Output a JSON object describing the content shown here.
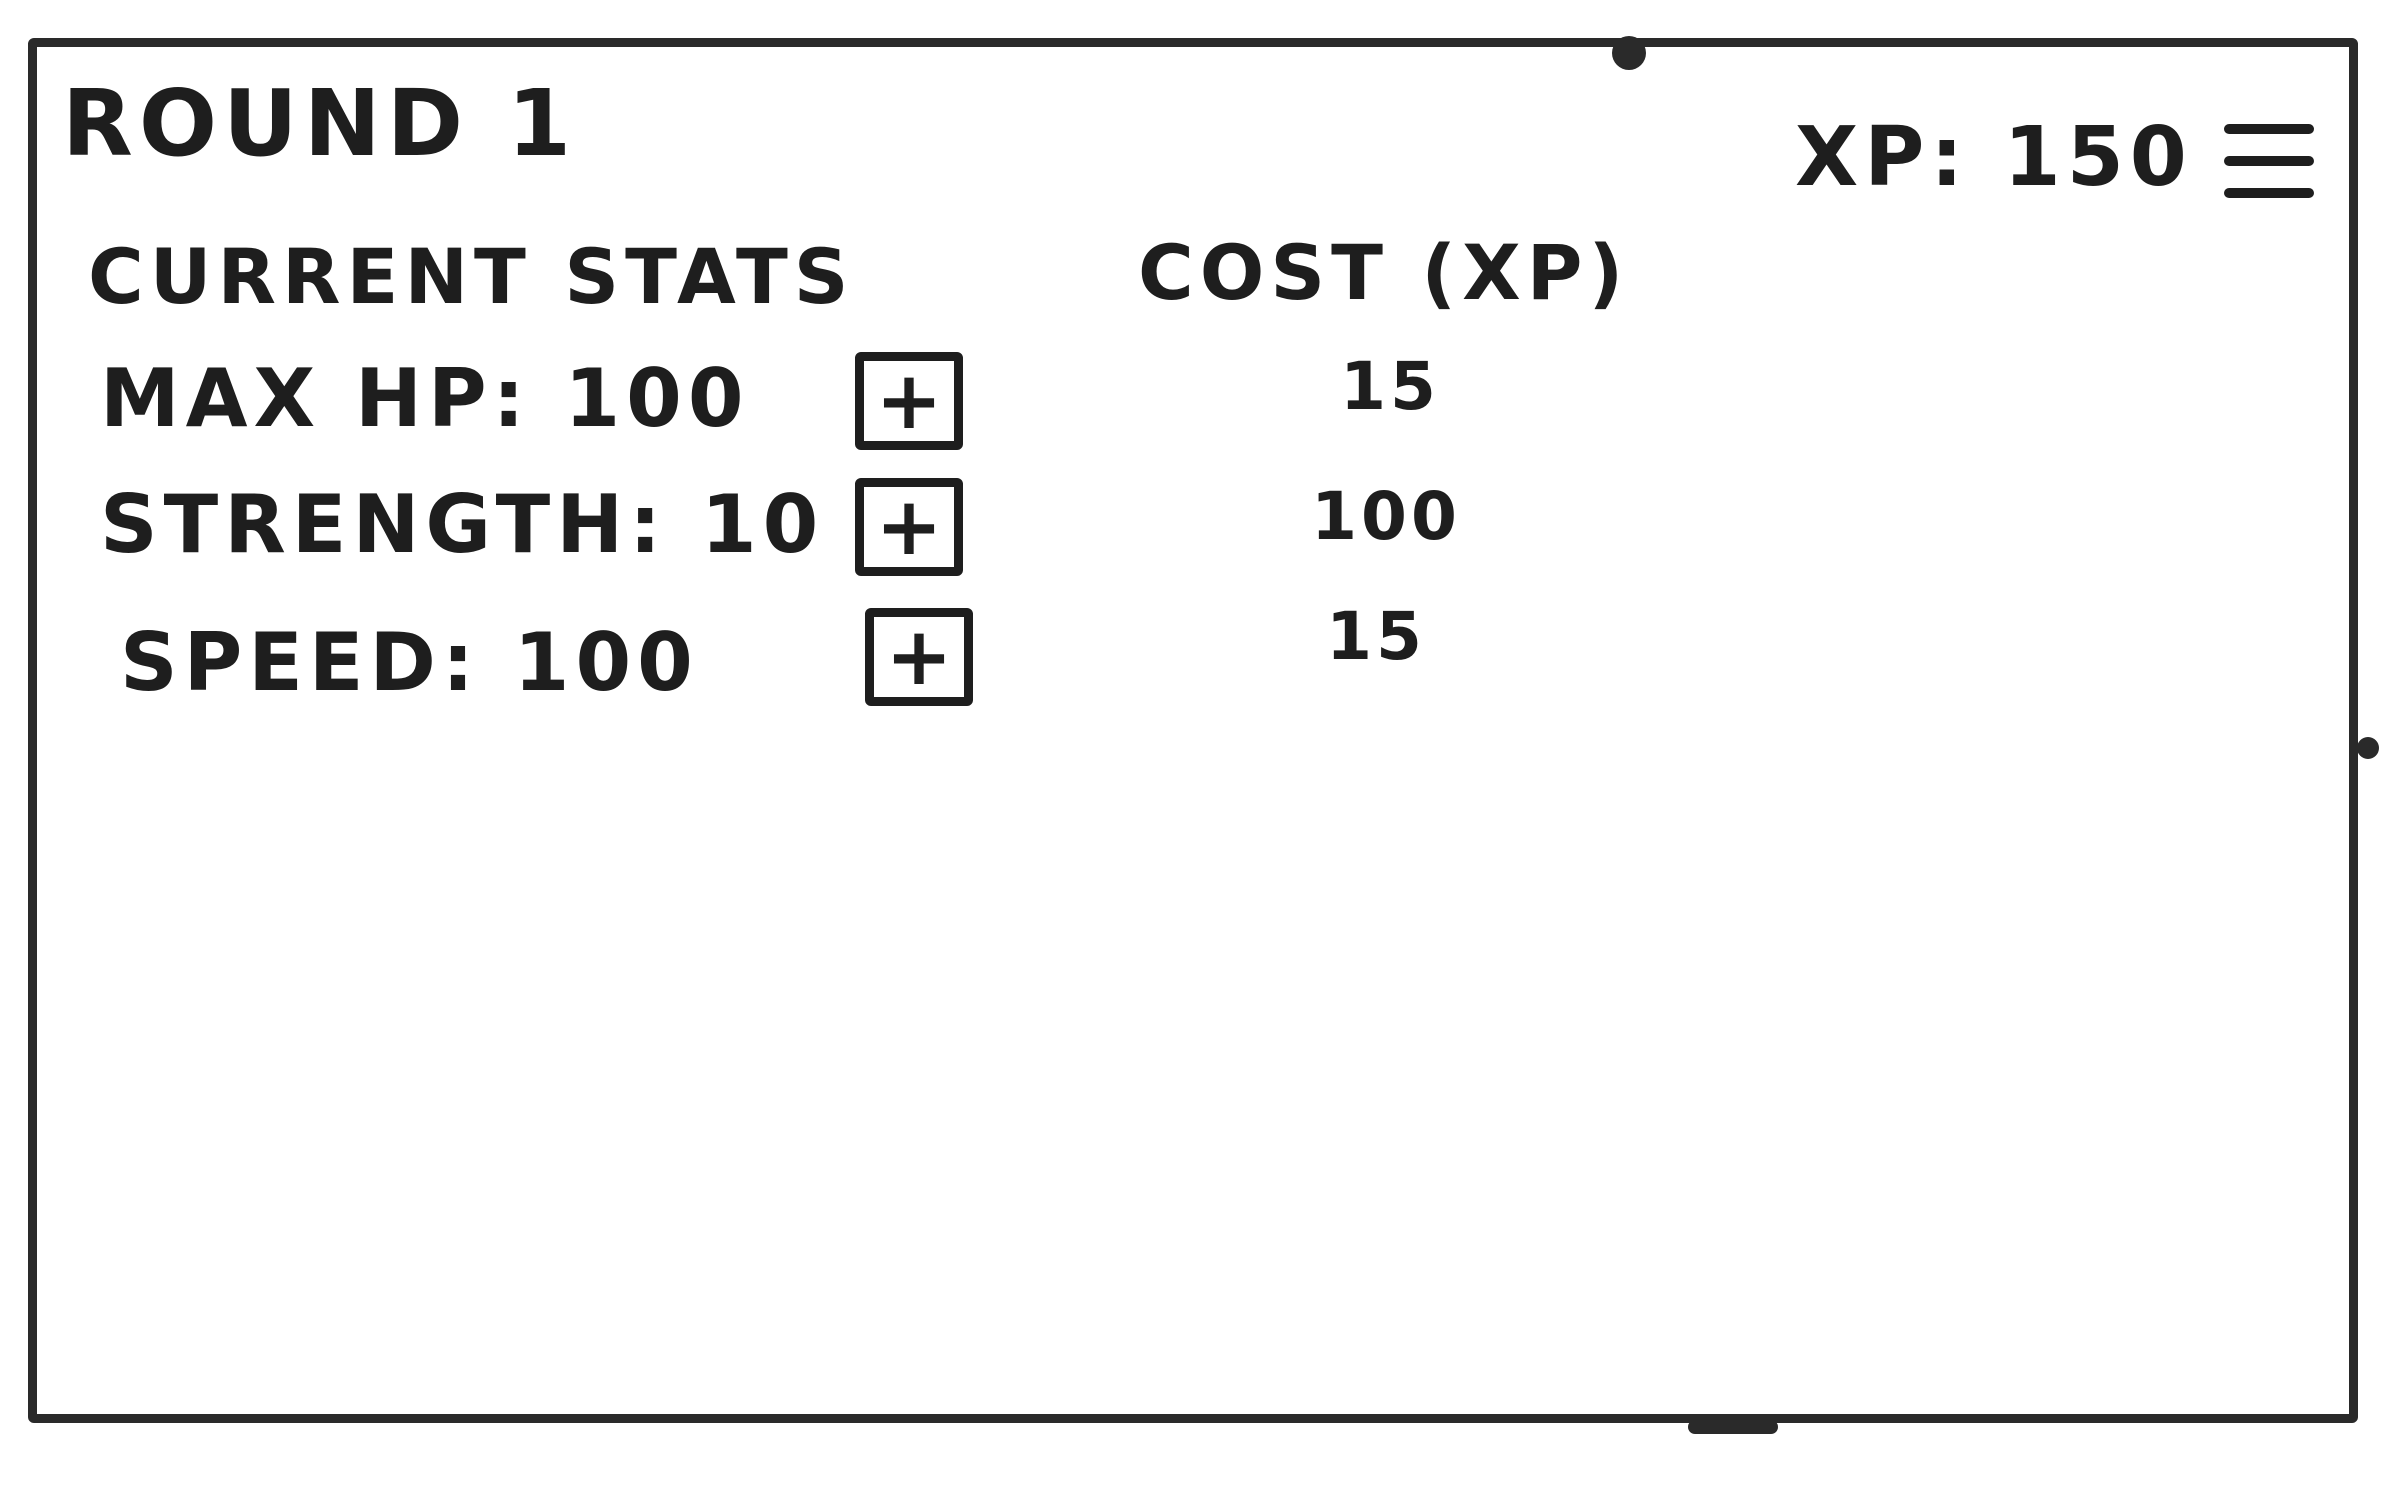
{
  "screen": {
    "round_title": "ROUND 1",
    "xp_label": "XP: 150",
    "menu_icon": "hamburger-menu-icon"
  },
  "table": {
    "stats_header": "CURRENT STATS",
    "cost_header": "COST (XP)",
    "rows": [
      {
        "label": "MAX HP: 100",
        "button_glyph": "+",
        "cost": "15"
      },
      {
        "label": "STRENGTH: 10",
        "button_glyph": "+",
        "cost": "100"
      },
      {
        "label": "SPEED: 100",
        "button_glyph": "+",
        "cost": "15"
      }
    ]
  },
  "colors": {
    "ink": "#1e1e1e",
    "paper": "#ffffff"
  }
}
